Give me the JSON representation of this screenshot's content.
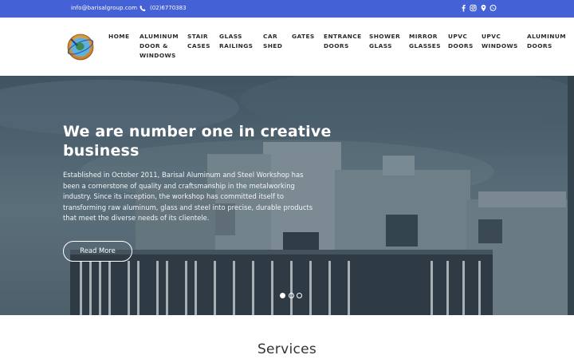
{
  "topbar": {
    "email": "info@barisalgroup.com",
    "phone": "(02)6770383",
    "bg_color": "#4461d6",
    "icons": [
      "phone-icon",
      "facebook-icon",
      "instagram-icon",
      "location-icon",
      "whatsapp-icon"
    ]
  },
  "nav": {
    "items": [
      {
        "lines": [
          "HOME"
        ]
      },
      {
        "lines": [
          "ALUMINUM",
          "DOOR &",
          "WINDOWS"
        ]
      },
      {
        "lines": [
          "STAIR",
          "CASES"
        ]
      },
      {
        "lines": [
          "GLASS",
          "RAILINGS"
        ]
      },
      {
        "lines": [
          "CAR",
          "SHED"
        ]
      },
      {
        "lines": [
          "GATES"
        ]
      },
      {
        "lines": [
          "ENTRANCE",
          "DOORS"
        ]
      },
      {
        "lines": [
          "SHOWER",
          "GLASS"
        ]
      },
      {
        "lines": [
          "MIRROR",
          "GLASSES"
        ]
      },
      {
        "lines": [
          "UPVC",
          "DOORS"
        ]
      },
      {
        "lines": [
          "UPVC",
          "WINDOWS"
        ]
      },
      {
        "lines": [
          "ALUMINUM",
          "DOORS"
        ]
      }
    ]
  },
  "hero": {
    "title": "We are number one in creative business",
    "text": "Established in October 2011, Barisal Aluminum and Steel Workshop has been a cornerstone of quality and craftsmanship in the metalworking industry. Since its inception, the workshop has committed itself to transforming raw aluminum, glass and steel into precise, durable products that meet the diverse needs of its clientele.",
    "button_label": "Read More",
    "slides": 3,
    "active_slide": 1
  },
  "services": {
    "title": "Services"
  }
}
